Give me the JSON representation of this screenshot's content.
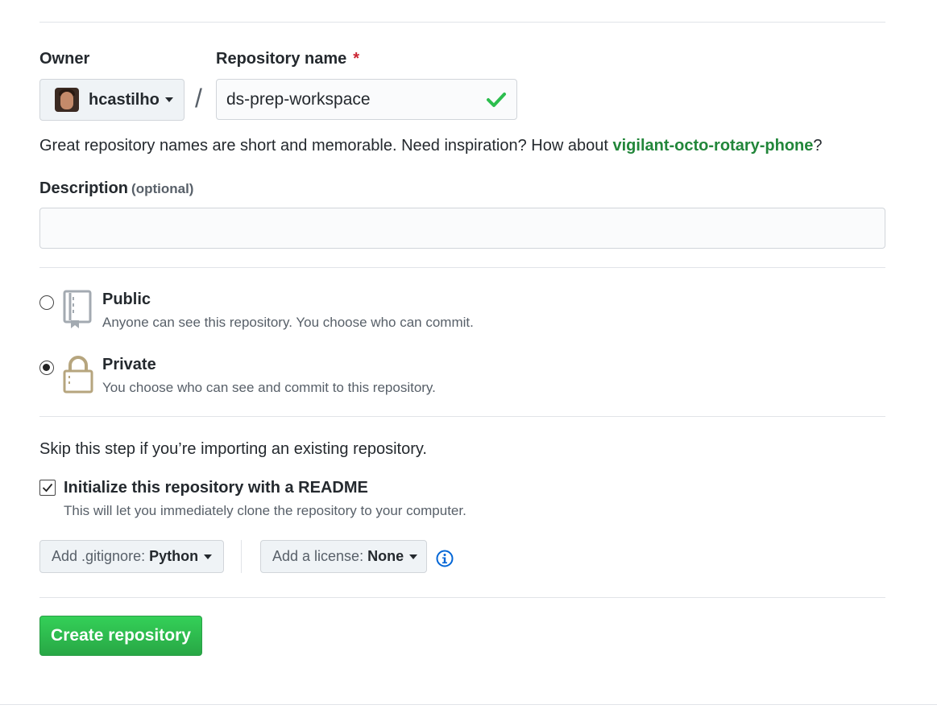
{
  "owner": {
    "label": "Owner",
    "name": "hcastilho"
  },
  "repo_name": {
    "label": "Repository name",
    "required_mark": "*",
    "value": "ds-prep-workspace",
    "separator": "/"
  },
  "hint": {
    "text": "Great repository names are short and memorable. Need inspiration? How about ",
    "suggestion": "vigilant-octo-rotary-phone",
    "suffix": "?"
  },
  "description": {
    "label": "Description",
    "optional": "(optional)",
    "value": ""
  },
  "visibility": {
    "selected": "private",
    "public": {
      "title": "Public",
      "desc": "Anyone can see this repository. You choose who can commit."
    },
    "private": {
      "title": "Private",
      "desc": "You choose who can see and commit to this repository."
    }
  },
  "init": {
    "skip_text": "Skip this step if you’re importing an existing repository.",
    "readme_label": "Initialize this repository with a README",
    "readme_desc": "This will let you immediately clone the repository to your computer.",
    "readme_checked": true
  },
  "gitignore": {
    "prefix": "Add .gitignore:",
    "value": "Python"
  },
  "license": {
    "prefix": "Add a license:",
    "value": "None"
  },
  "submit_label": "Create repository",
  "colors": {
    "accent_green": "#28a745",
    "link_green": "#22863a",
    "required_red": "#cb2431",
    "info_blue": "#0366d6",
    "lock_gold": "#b6a57e"
  },
  "icons": [
    "chevron-down-icon",
    "check-icon",
    "repo-icon",
    "lock-icon",
    "info-icon"
  ]
}
